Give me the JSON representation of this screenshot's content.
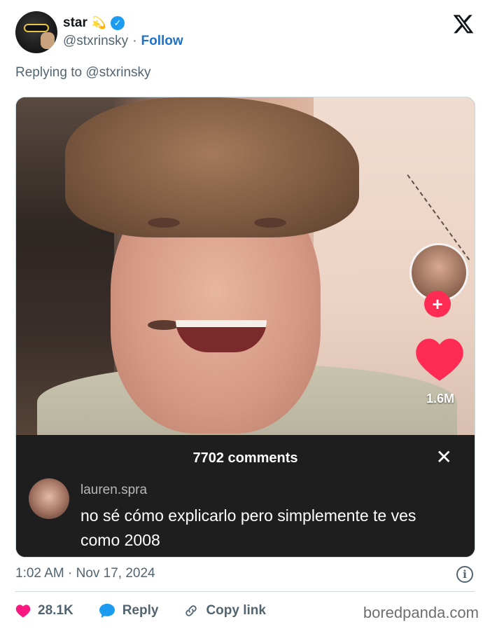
{
  "author": {
    "name": "star",
    "emoji": "💫",
    "handle": "@stxrinsky",
    "separator": "·",
    "follow_label": "Follow"
  },
  "reply_context": "Replying to @stxrinsky",
  "media": {
    "likes_count": "1.6M",
    "comments": {
      "title": "7702 comments",
      "commenter": "lauren.spra",
      "text": "no sé cómo explicarlo pero simplemente te ves como 2008"
    }
  },
  "timestamp": "1:02 AM · Nov 17, 2024",
  "actions": {
    "like_count": "28.1K",
    "reply_label": "Reply",
    "copy_label": "Copy link"
  },
  "watermark": "boredpanda.com",
  "colors": {
    "accent": "#1d9bf0",
    "follow": "#1d72c9",
    "like": "#f91880",
    "tiktok_red": "#fe2c55"
  }
}
